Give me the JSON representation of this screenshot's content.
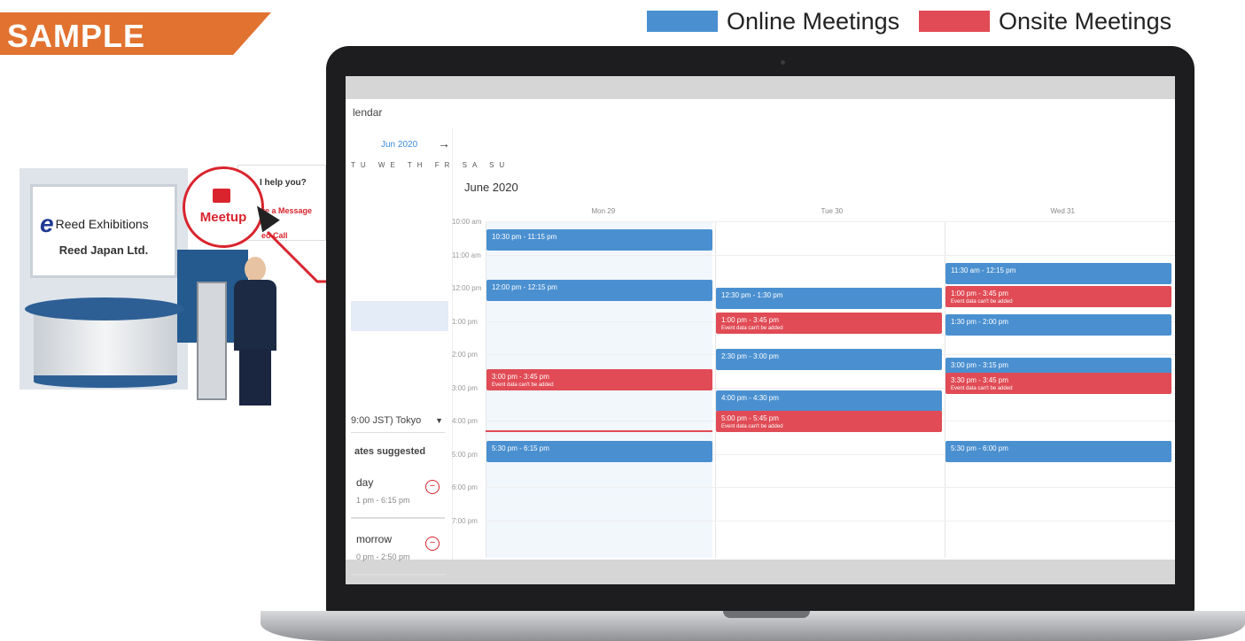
{
  "sample": {
    "label": "SAMPLE"
  },
  "legend": [
    {
      "label": "Online Meetings",
      "color": "#4a90d0"
    },
    {
      "label": "Onsite Meetings",
      "color": "#e04b55"
    }
  ],
  "booth": {
    "logo_text": "Reed Exhibitions",
    "company": "Reed Japan Ltd.",
    "panel_question": "I help you?",
    "panel_message": "ave a Message",
    "panel_video": "eo Call",
    "meetup_label": "Meetup"
  },
  "app": {
    "title": "lendar",
    "mini_month": "Jun 2020",
    "mini_days": "TU WE TH FR SA SU",
    "timezone": "9:00 JST) Tokyo",
    "suggested_title": "ates suggested",
    "suggestions": [
      {
        "day": "day",
        "time": "1 pm - 6:15 pm"
      },
      {
        "day": "morrow",
        "time": "0 pm - 2:50 pm"
      }
    ],
    "calendar_title": "June 2020",
    "days": [
      "Mon 29",
      "Tue 30",
      "Wed 31"
    ],
    "hours": [
      "10:00 am",
      "11:00 am",
      "12:00 pm",
      "1:00 pm",
      "2:00 pm",
      "3:00 pm",
      "4:00 pm",
      "5:00 pm",
      "6:00 pm",
      "7:00 pm"
    ],
    "events": [
      {
        "day": 0,
        "start": 10.25,
        "type": "online",
        "label": "10:30 pm - 11:15 pm",
        "sub": ""
      },
      {
        "day": 0,
        "start": 11.75,
        "type": "online",
        "label": "12:00 pm - 12:15 pm",
        "sub": ""
      },
      {
        "day": 0,
        "start": 14.45,
        "type": "onsite",
        "label": "3:00 pm - 3:45 pm",
        "sub": "Event data can't be added"
      },
      {
        "day": 0,
        "start": 16.6,
        "type": "online",
        "label": "5:30 pm - 6:15 pm",
        "sub": ""
      },
      {
        "day": 1,
        "start": 12.0,
        "type": "online",
        "label": "12:30 pm - 1:30 pm",
        "sub": ""
      },
      {
        "day": 1,
        "start": 12.75,
        "type": "onsite",
        "label": "1:00 pm - 3:45 pm",
        "sub": "Event data can't be added"
      },
      {
        "day": 1,
        "start": 13.85,
        "type": "online",
        "label": "2:30 pm - 3:00 pm",
        "sub": ""
      },
      {
        "day": 1,
        "start": 15.1,
        "type": "online",
        "label": "4:00 pm - 4:30 pm",
        "sub": ""
      },
      {
        "day": 1,
        "start": 15.7,
        "type": "onsite",
        "label": "5:00 pm - 5:45 pm",
        "sub": "Event data can't be added"
      },
      {
        "day": 2,
        "start": 11.25,
        "type": "online",
        "label": "11:30 am - 12:15 pm",
        "sub": ""
      },
      {
        "day": 2,
        "start": 11.95,
        "type": "onsite",
        "label": "1:00 pm - 3:45 pm",
        "sub": "Event data can't be added"
      },
      {
        "day": 2,
        "start": 12.8,
        "type": "online",
        "label": "1:30 pm - 2:00 pm",
        "sub": ""
      },
      {
        "day": 2,
        "start": 14.1,
        "type": "online",
        "label": "3:00 pm - 3:15 pm",
        "sub": ""
      },
      {
        "day": 2,
        "start": 14.55,
        "type": "onsite",
        "label": "3:30 pm - 3:45 pm",
        "sub": "Event data can't be added"
      },
      {
        "day": 2,
        "start": 16.6,
        "type": "online",
        "label": "5:30 pm - 6:00 pm",
        "sub": ""
      }
    ]
  }
}
